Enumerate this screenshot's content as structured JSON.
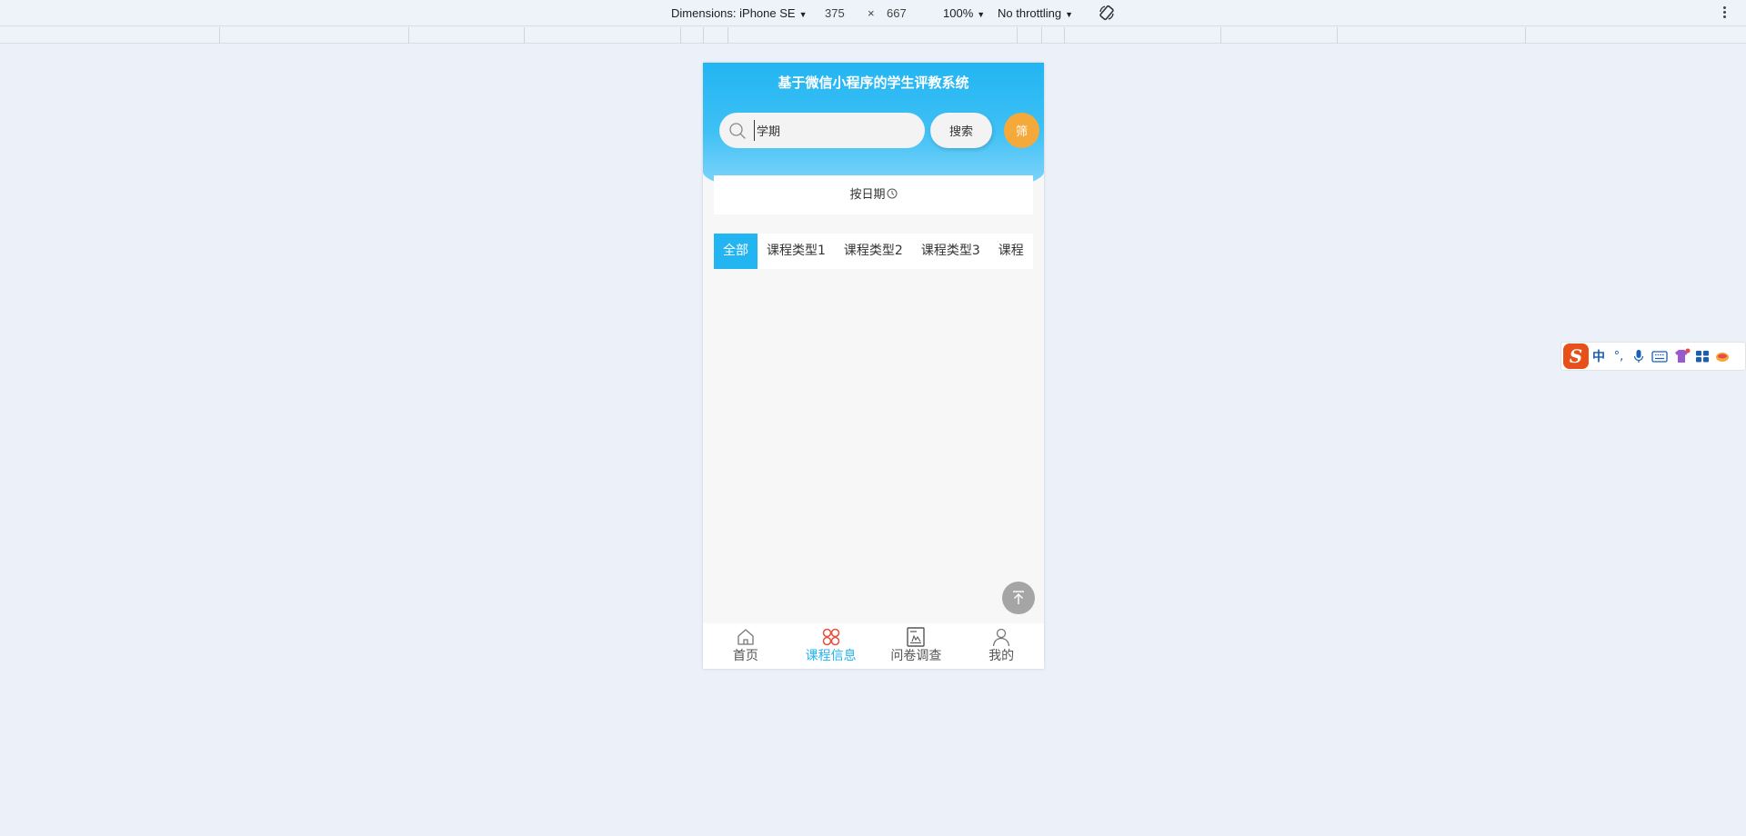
{
  "devtools": {
    "dimensions_label": "Dimensions: iPhone SE",
    "width": "375",
    "times": "×",
    "height": "667",
    "zoom": "100%",
    "throttling": "No throttling"
  },
  "app": {
    "title": "基于微信小程序的学生评教系统",
    "search": {
      "value": "学期",
      "button_label": "搜索",
      "filter_label": "筛"
    },
    "date_sort_label": "按日期",
    "tabs": [
      {
        "label": "全部",
        "active": true
      },
      {
        "label": "课程类型1",
        "active": false
      },
      {
        "label": "课程类型2",
        "active": false
      },
      {
        "label": "课程类型3",
        "active": false
      },
      {
        "label": "课程",
        "active": false
      }
    ],
    "bottom_nav": [
      {
        "label": "首页",
        "icon": "home-icon",
        "active": false
      },
      {
        "label": "课程信息",
        "icon": "clover-icon",
        "active": true
      },
      {
        "label": "问卷调查",
        "icon": "survey-icon",
        "active": false
      },
      {
        "label": "我的",
        "icon": "user-icon",
        "active": false
      }
    ],
    "colors": {
      "primary": "#22b5f2",
      "filter": "#f5a93a",
      "active_icon": "#e8503c"
    }
  },
  "ime": {
    "logo": "S",
    "mode": "中",
    "punct": "°,"
  }
}
